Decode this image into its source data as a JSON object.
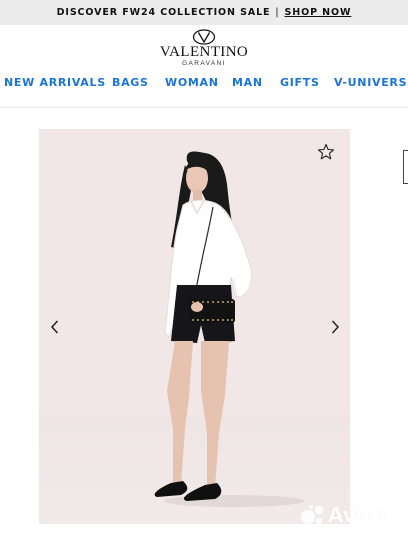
{
  "promo": {
    "text": "DISCOVER FW24 COLLECTION SALE",
    "separator": "|",
    "link": "SHOP NOW"
  },
  "brand": {
    "name": "VALENTINO",
    "sub": "GARAVANI",
    "monogram": "V"
  },
  "nav": {
    "items": [
      {
        "label": "NEW ARRIVALS"
      },
      {
        "label": "BAGS"
      },
      {
        "label": "WOMAN"
      },
      {
        "label": "MAN"
      },
      {
        "label": "GIFTS"
      },
      {
        "label": "V-UNIVERSE"
      }
    ]
  },
  "product": {
    "icons": {
      "favorite": "star-icon",
      "previous": "chevron-left-icon",
      "next": "chevron-right-icon"
    }
  },
  "watermark": {
    "text": "Avito"
  },
  "colors": {
    "nav_link": "#1b74d8",
    "promo_bg": "#ececec",
    "image_bg": "#f0e7e6"
  }
}
